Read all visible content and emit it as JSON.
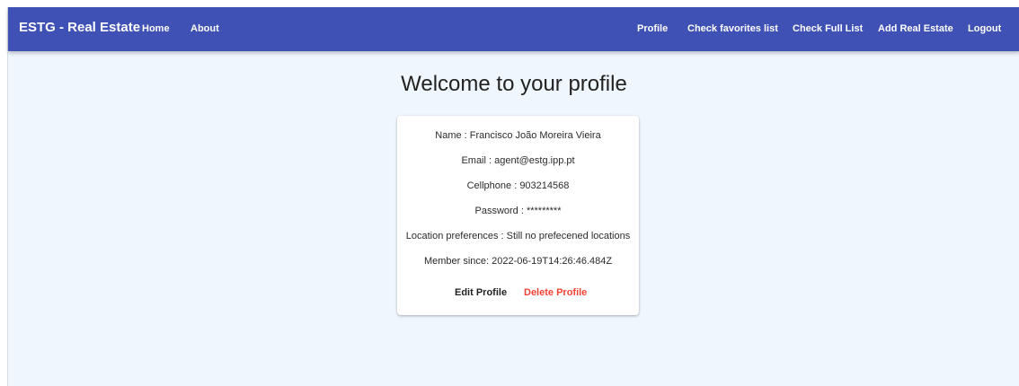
{
  "nav": {
    "brand": "ESTG - Real Estate",
    "home": "Home",
    "about": "About",
    "profile": "Profile",
    "favorites": "Check favorites list",
    "full_list": "Check Full List",
    "add_real_estate": "Add Real Estate",
    "logout": "Logout"
  },
  "page": {
    "title": "Welcome to your profile"
  },
  "profile": {
    "name": "Name : Francisco João Moreira Vieira",
    "email": "Email : agent@estg.ipp.pt",
    "cellphone": "Cellphone : 903214568",
    "password": "Password : *********",
    "location": "Location preferences : Still no prefecened locations",
    "member_since": "Member since: 2022-06-19T14:26:46.484Z"
  },
  "actions": {
    "edit": "Edit Profile",
    "delete": "Delete Profile"
  },
  "colors": {
    "navbar": "#3f51b5",
    "background": "#eff6fe",
    "delete": "#f44336"
  }
}
